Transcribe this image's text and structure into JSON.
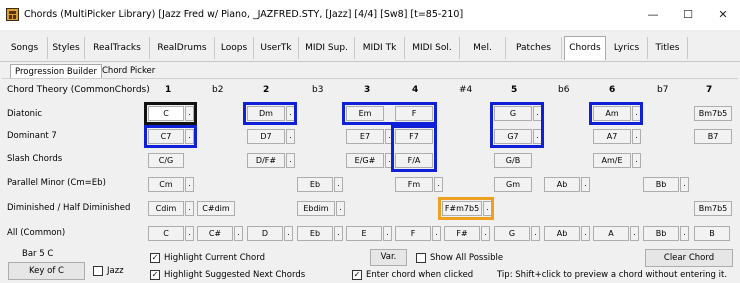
{
  "window": {
    "title": "Chords  (MultiPicker Library)  [Jazz Fred w/ Piano, _JAZFRED.STY,  [Jazz] [4/4] [Sw8] [t=85-210]",
    "minimize": "—",
    "maximize": "☐",
    "close": "✕"
  },
  "tabs": [
    "Songs",
    "Styles",
    "RealTracks",
    "RealDrums",
    "Loops",
    "UserTk",
    "MIDI Sup.",
    "MIDI Tk",
    "MIDI Sol.",
    "Mel.",
    "Patches",
    "Chords",
    "Lyrics",
    "Titles"
  ],
  "subtabs": [
    "Progression Builder",
    "Chord Picker"
  ],
  "header": {
    "theory_label": "Chord Theory (CommonChords)",
    "degrees": [
      "1",
      "b2",
      "2",
      "b3",
      "3",
      "4",
      "#4",
      "5",
      "b6",
      "6",
      "b7",
      "7"
    ]
  },
  "rows": {
    "diatonic": "Diatonic",
    "dominant7": "Dominant 7",
    "slash": "Slash Chords",
    "parallel_minor": "Parallel Minor (Cm=Eb)",
    "diminished": "Diminished / Half Diminished",
    "all": "All (Common)"
  },
  "chords": {
    "diatonic": [
      "C",
      "Dm",
      "Em",
      "F",
      "G",
      "Am",
      "Bm7b5"
    ],
    "dominant7": [
      "C7",
      "D7",
      "E7",
      "F7",
      "G7",
      "A7",
      "B7"
    ],
    "slash": [
      "C/G",
      "D/F#",
      "E/G#",
      "F/A",
      "G/B",
      "Am/E"
    ],
    "parallel_minor": [
      "Cm",
      "Eb",
      "Fm",
      "Gm",
      "Ab",
      "Bb"
    ],
    "diminished": [
      "Cdim",
      "C#dim",
      "Ebdim",
      "F#m7b5",
      "Bm7b5"
    ],
    "all": [
      "C",
      "C#",
      "D",
      "Eb",
      "E",
      "F",
      "F#",
      "G",
      "Ab",
      "A",
      "Bb",
      "B"
    ]
  },
  "dot_label": ".",
  "bottom": {
    "bar_label": "Bar 5 C",
    "key_button": "Key of C",
    "jazz_label": "Jazz",
    "highlight_current": "Highlight Current Chord",
    "highlight_suggested": "Highlight Suggested Next Chords",
    "var_button": "Var.",
    "show_all": "Show All Possible",
    "enter_chord": "Enter chord when clicked",
    "tip": "Tip: Shift+click to preview a chord without entering it.",
    "clear_button": "Clear Chord",
    "check_mark": "✓"
  },
  "colors": {
    "suggested_highlight": "#1020d8",
    "current_highlight": "#111111",
    "special_highlight": "#f0a020"
  }
}
